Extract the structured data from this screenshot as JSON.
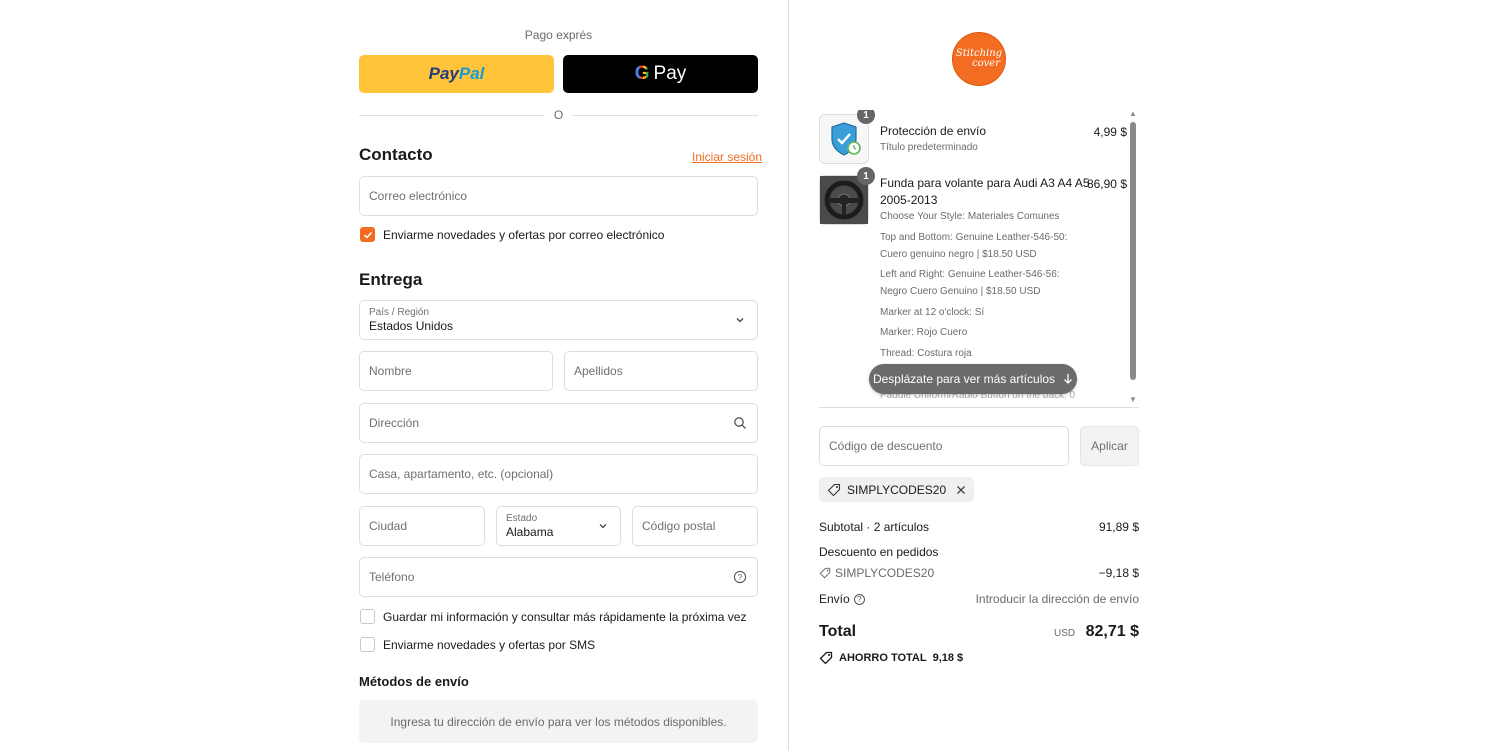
{
  "express": {
    "label": "Pago exprés",
    "paypal_a": "Pay",
    "paypal_b": "Pal",
    "gpay_g": "G",
    "gpay_text": "Pay",
    "or": "O"
  },
  "contact": {
    "title": "Contacto",
    "login_link": "Iniciar sesión",
    "email_placeholder": "Correo electrónico",
    "newsletter_label": "Enviarme novedades y ofertas por correo electrónico",
    "newsletter_checked": true
  },
  "delivery": {
    "title": "Entrega",
    "country_label": "País / Región",
    "country_value": "Estados Unidos",
    "first_name": "Nombre",
    "last_name": "Apellidos",
    "address": "Dirección",
    "apartment": "Casa, apartamento, etc. (opcional)",
    "city": "Ciudad",
    "state_label": "Estado",
    "state_value": "Alabama",
    "zip": "Código postal",
    "phone": "Teléfono",
    "save_info_label": "Guardar mi información y consultar más rápidamente la próxima vez",
    "sms_label": "Enviarme novedades y ofertas por SMS"
  },
  "shipping": {
    "title": "Métodos de envío",
    "info": "Ingresa tu dirección de envío para ver los métodos disponibles."
  },
  "brand": {
    "line1": "Stitching",
    "line2": "cover",
    "color": "#f26c22"
  },
  "cart": {
    "items": [
      {
        "qty": "1",
        "title": "Protección de envío",
        "subtitle": "Título predeterminado",
        "price": "4,99 $"
      },
      {
        "qty": "1",
        "title_line1": "Funda para volante para Audi A3 A4 A5",
        "title_line2": "2005-2013",
        "price": "86,90 $",
        "options": [
          "Choose Your Style: Materiales Comunes",
          "Top and Bottom: Genuine Leather-546-50:",
          "Cuero genuino negro | $18.50 USD",
          "Left and Right: Genuine Leather-546-56:",
          "Negro Cuero Genuino | $18.50 USD",
          "Marker at 12 o'clock: Sí",
          "Marker: Rojo Cuero",
          "Thread: Costura roja"
        ],
        "peek": "Paddle Uniform/Radio Button on the back: 0"
      }
    ],
    "scroll_hint": "Desplázate para ver más artículos"
  },
  "discount": {
    "placeholder": "Código de descuento",
    "apply": "Aplicar",
    "applied_code": "SIMPLYCODES20"
  },
  "summary": {
    "subtotal_label": "Subtotal · 2 artículos",
    "subtotal_value": "91,89 $",
    "order_discount_label": "Descuento en pedidos",
    "discount_code": "SIMPLYCODES20",
    "discount_value": "−9,18 $",
    "shipping_label": "Envío",
    "shipping_value": "Introducir la dirección de envío",
    "total_label": "Total",
    "total_currency": "USD",
    "total_value": "82,71 $",
    "saving_label": "AHORRO TOTAL",
    "saving_value": "9,18 $"
  }
}
